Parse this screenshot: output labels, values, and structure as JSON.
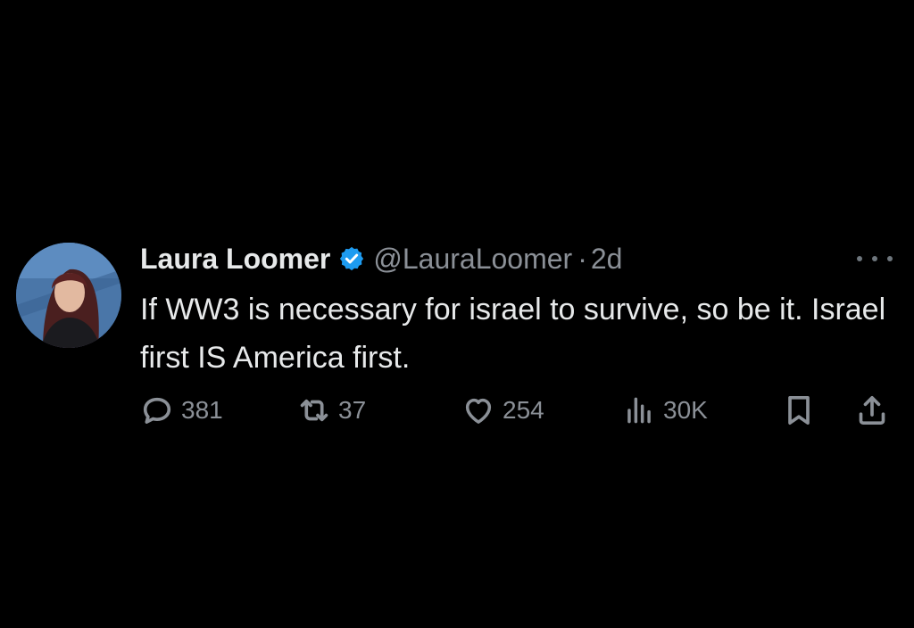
{
  "tweet": {
    "author": {
      "name": "Laura Loomer",
      "handle": "@LauraLoomer",
      "verified": true
    },
    "separator": "·",
    "time": "2d",
    "text": "If WW3 is necessary for israel to survive, so be it. Israel first IS America first.",
    "stats": {
      "replies": "381",
      "reposts": "37",
      "likes": "254",
      "views": "30K"
    }
  },
  "colors": {
    "background": "#000000",
    "primary_text": "#e7e9ea",
    "secondary_text": "#8b9097",
    "verified_badge": "#1d9bf0"
  },
  "icons": [
    "verified-badge-icon",
    "more-options-icon",
    "reply-icon",
    "repost-icon",
    "like-icon",
    "views-icon",
    "bookmark-icon",
    "share-icon"
  ]
}
